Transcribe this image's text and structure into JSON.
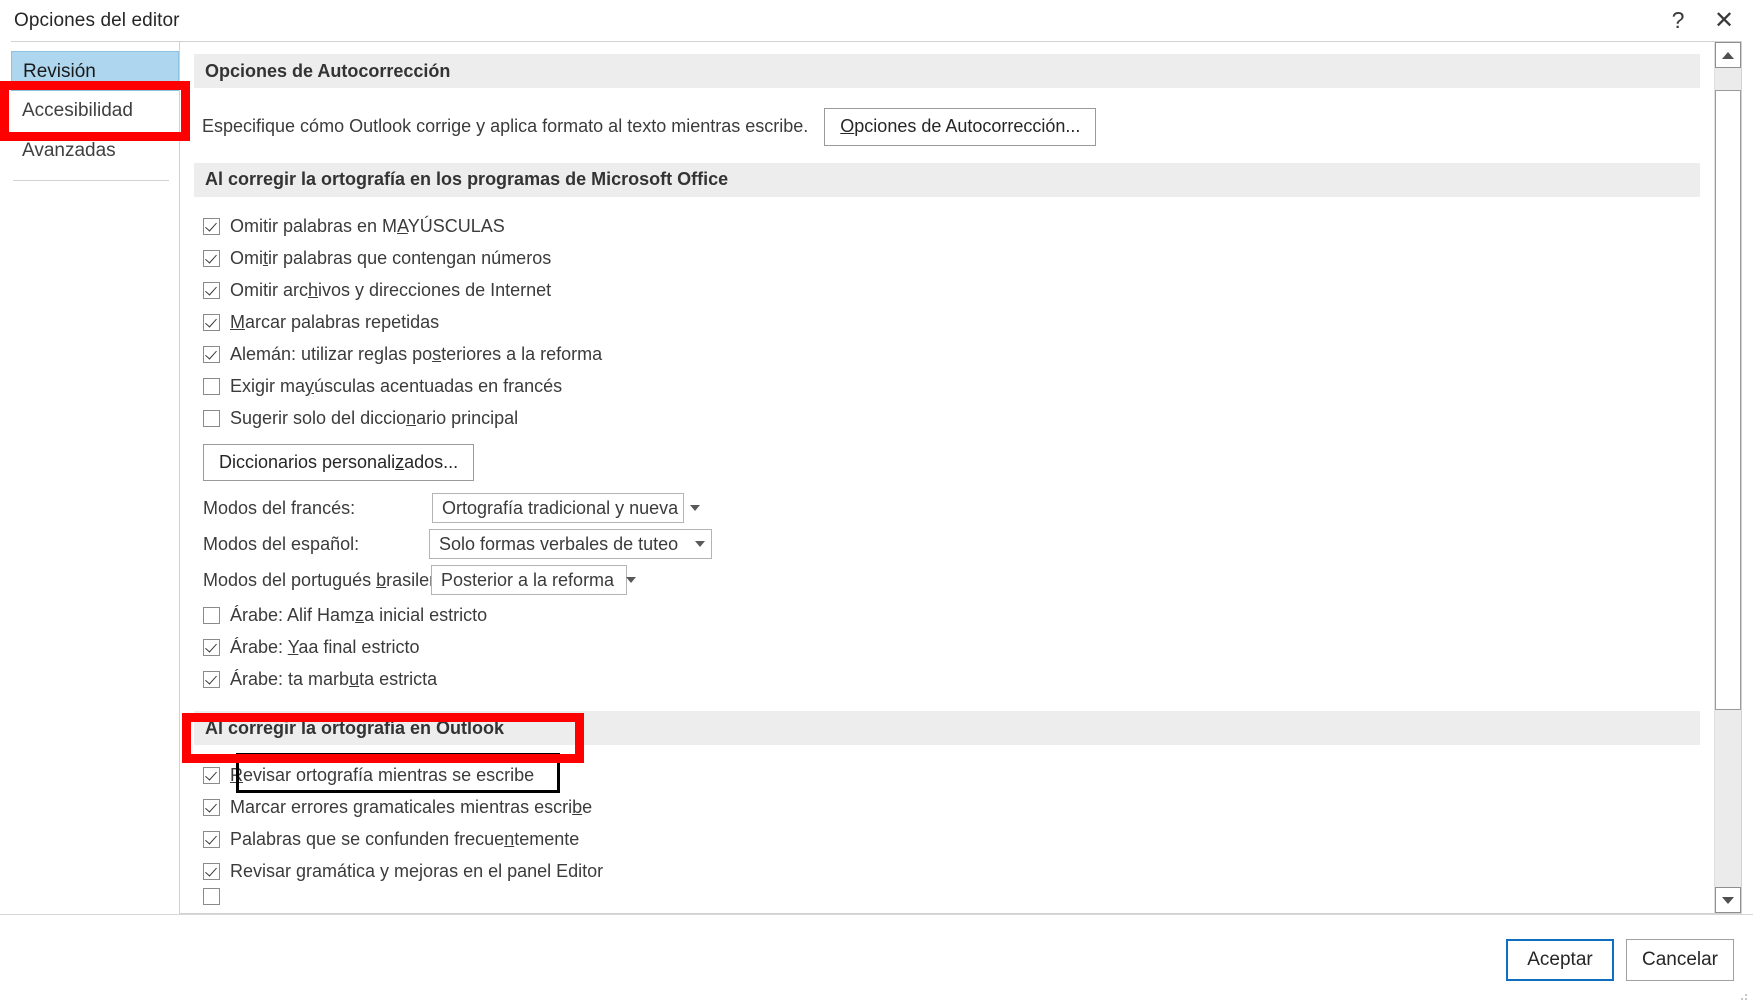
{
  "window": {
    "title": "Opciones del editor",
    "help_icon": "?",
    "close_icon": "✕"
  },
  "nav": {
    "items": [
      {
        "label": "Revisión",
        "selected": true
      },
      {
        "label": "Accesibilidad",
        "selected": false
      },
      {
        "label": "Avanzadas",
        "selected": false
      }
    ]
  },
  "content": {
    "section_autocorrect": {
      "band_title": "Opciones de Autocorrección",
      "description": "Especifique cómo Outlook corrige y aplica formato al texto mientras escribe.",
      "button_label": "Opciones de Autocorrección..."
    },
    "section_office": {
      "band_title": "Al corregir la ortografía en los programas de Microsoft Office",
      "options": [
        {
          "label": "Omitir palabras en MAYÚSCULAS",
          "checked": true
        },
        {
          "label": "Omitir palabras que contengan números",
          "checked": true
        },
        {
          "label": "Omitir archivos y direcciones de Internet",
          "checked": true
        },
        {
          "label": "Marcar palabras repetidas",
          "checked": true
        },
        {
          "label": "Alemán: utilizar reglas posteriores a la reforma",
          "checked": true
        },
        {
          "label": "Exigir mayúsculas acentuadas en francés",
          "checked": false
        },
        {
          "label": "Sugerir solo del diccionario principal",
          "checked": false
        }
      ],
      "custom_dictionaries_button": "Diccionarios personalizados...",
      "modes": [
        {
          "label": "Modos del francés:",
          "value": "Ortografía tradicional y nueva"
        },
        {
          "label": "Modos del español:",
          "value": "Solo formas verbales de tuteo"
        },
        {
          "label": "Modos del portugués brasileño:",
          "value": "Posterior a la reforma"
        }
      ],
      "arabic_options": [
        {
          "label": "Árabe: Alif Hamza inicial estricto",
          "checked": false
        },
        {
          "label": "Árabe: Yaa final estricto",
          "checked": true
        },
        {
          "label": "Árabe: ta marbuta estricta",
          "checked": true
        }
      ]
    },
    "section_outlook": {
      "band_title": "Al corregir la ortografía en Outlook",
      "options": [
        {
          "label": "Revisar ortografía mientras se escribe",
          "checked": true,
          "highlight": "red"
        },
        {
          "label": "Marcar errores gramaticales mientras escribe",
          "checked": true,
          "highlight": "black"
        },
        {
          "label": "Palabras que se confunden frecuentemente",
          "checked": true,
          "highlight": "none"
        },
        {
          "label": "Revisar gramática y mejoras en el panel Editor",
          "checked": true,
          "highlight": "none"
        }
      ]
    }
  },
  "scrollbar": {
    "up_icon": "scroll-up-arrow",
    "down_icon": "scroll-down-arrow"
  },
  "footer": {
    "accept_label": "Aceptar",
    "cancel_label": "Cancelar"
  },
  "colors": {
    "highlight_red": "#ff0000",
    "highlight_black": "#000000",
    "nav_selected": "#aed7ef",
    "primary_border": "#106ebe",
    "band_bg": "#ededed"
  }
}
